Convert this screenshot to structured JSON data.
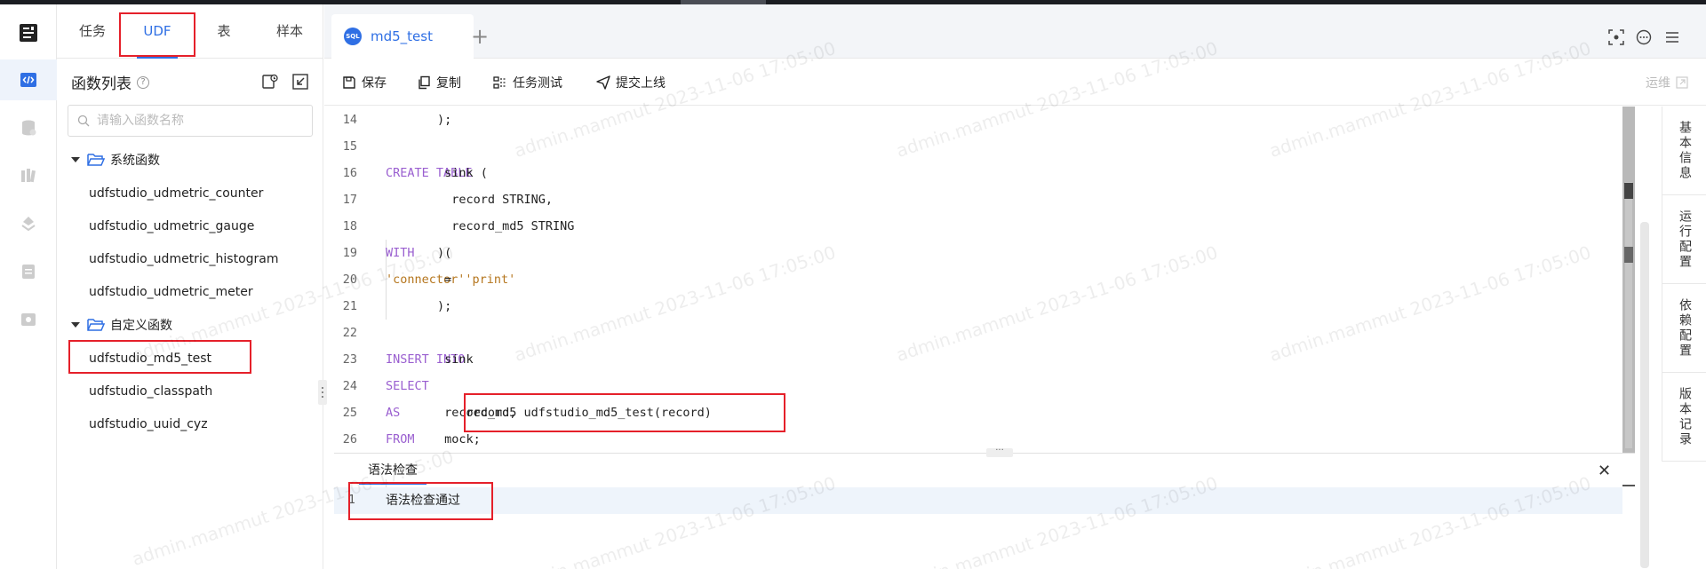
{
  "panel": {
    "tabs": [
      "任务",
      "UDF",
      "表",
      "样本"
    ],
    "title": "函数列表",
    "help": "?",
    "search_placeholder": "请输入函数名称",
    "groups": [
      {
        "label": "系统函数",
        "items": [
          "udfstudio_udmetric_counter",
          "udfstudio_udmetric_gauge",
          "udfstudio_udmetric_histogram",
          "udfstudio_udmetric_meter"
        ]
      },
      {
        "label": "自定义函数",
        "items": [
          "udfstudio_md5_test",
          "udfstudio_classpath",
          "udfstudio_uuid_cyz"
        ]
      }
    ]
  },
  "editor": {
    "tab_name": "md5_test",
    "tab_icon_text": "SQL",
    "add_tab": "+",
    "toolbar": {
      "save": "保存",
      "copy": "复制",
      "test": "任务测试",
      "submit": "提交上线",
      "ops": "运维"
    },
    "lines": [
      {
        "n": "14",
        "tokens": [
          {
            "t": ");",
            "c": "tx"
          }
        ]
      },
      {
        "n": "15",
        "tokens": []
      },
      {
        "n": "16",
        "tokens": [
          {
            "t": "CREATE TABLE",
            "c": "kw"
          },
          {
            "t": " sink (",
            "c": "tx"
          }
        ]
      },
      {
        "n": "17",
        "tokens": [
          {
            "t": "  record STRING,",
            "c": "tx"
          }
        ]
      },
      {
        "n": "18",
        "tokens": [
          {
            "t": "  record_md5 STRING",
            "c": "tx"
          }
        ]
      },
      {
        "n": "19",
        "tokens": [
          {
            "t": ") ",
            "c": "tx"
          },
          {
            "t": "WITH",
            "c": "kw"
          },
          {
            "t": " (",
            "c": "tx"
          }
        ]
      },
      {
        "n": "20",
        "tokens": [
          {
            "t": "  ",
            "c": "tx"
          },
          {
            "t": "'connector'",
            "c": "str"
          },
          {
            "t": " = ",
            "c": "tx"
          },
          {
            "t": "'print'",
            "c": "str"
          }
        ]
      },
      {
        "n": "21",
        "tokens": [
          {
            "t": ");",
            "c": "tx"
          }
        ]
      },
      {
        "n": "22",
        "tokens": []
      },
      {
        "n": "23",
        "tokens": [
          {
            "t": "INSERT INTO",
            "c": "kw"
          },
          {
            "t": " sink",
            "c": "tx"
          }
        ]
      },
      {
        "n": "24",
        "tokens": [
          {
            "t": "SELECT",
            "c": "kw"
          }
        ]
      },
      {
        "n": "25",
        "tokens": [
          {
            "t": "    record, udfstudio_md5_test(record) ",
            "c": "tx"
          },
          {
            "t": "AS",
            "c": "kw"
          },
          {
            "t": " record_md5",
            "c": "tx"
          }
        ]
      },
      {
        "n": "26",
        "tokens": [
          {
            "t": "FROM",
            "c": "kw"
          },
          {
            "t": " mock;",
            "c": "tx"
          }
        ]
      }
    ]
  },
  "bottom": {
    "tab": "语法检查",
    "close": "✕",
    "result_line": "1",
    "result_msg": "语法检查通过"
  },
  "side_tabs": [
    "基本信息",
    "运行配置",
    "依赖配置",
    "版本记录"
  ],
  "watermark": "admin.mammut 2023-11-06 17:05:00",
  "colors": {
    "accent": "#2f6fe4",
    "keyword": "#9a5fd0",
    "string": "#b5761e",
    "highlight": "#e5202a"
  }
}
